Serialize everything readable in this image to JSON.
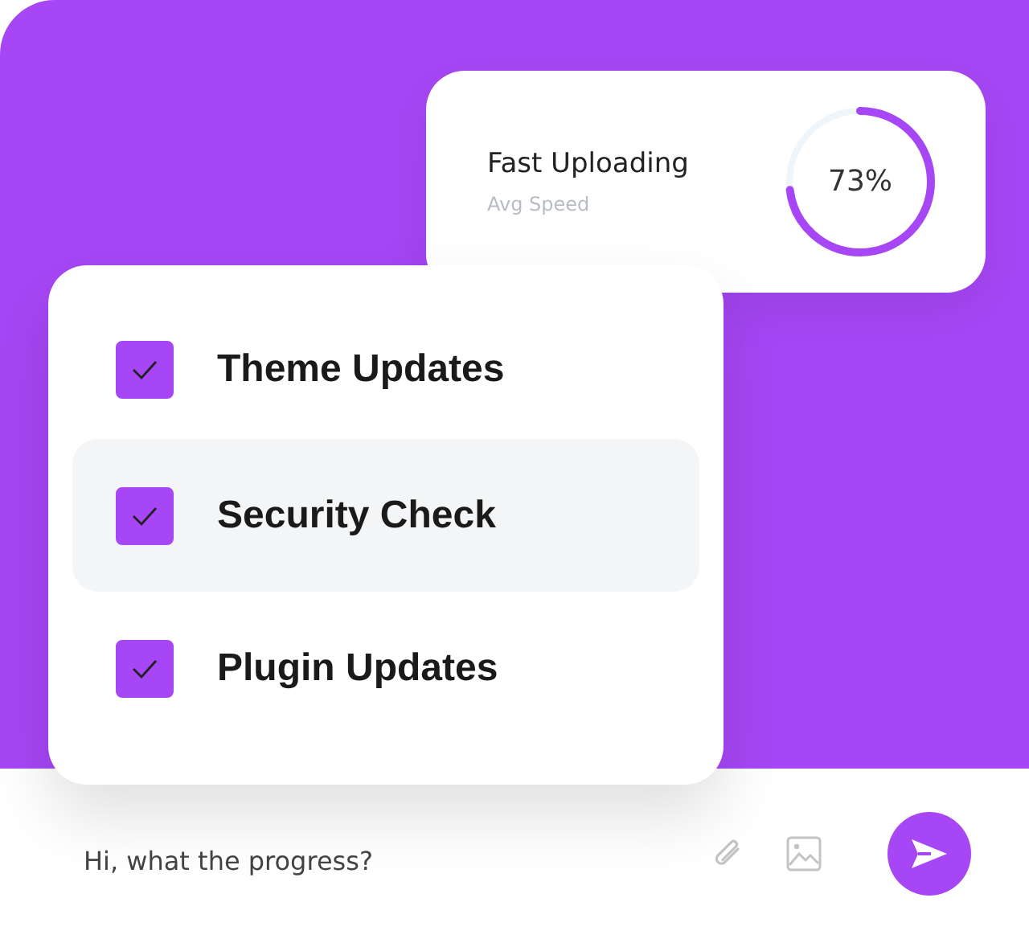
{
  "upload_card": {
    "title": "Fast Uploading",
    "subtitle": "Avg Speed",
    "reading": "73%",
    "level": 0.73
  },
  "tasks": [
    {
      "label": "Theme Updates",
      "checked": true,
      "selected": false
    },
    {
      "label": "Security Check",
      "checked": true,
      "selected": true
    },
    {
      "label": "Plugin Updates",
      "checked": true,
      "selected": false
    }
  ],
  "chat_bar": {
    "value": "Hi, what the progress?"
  }
}
